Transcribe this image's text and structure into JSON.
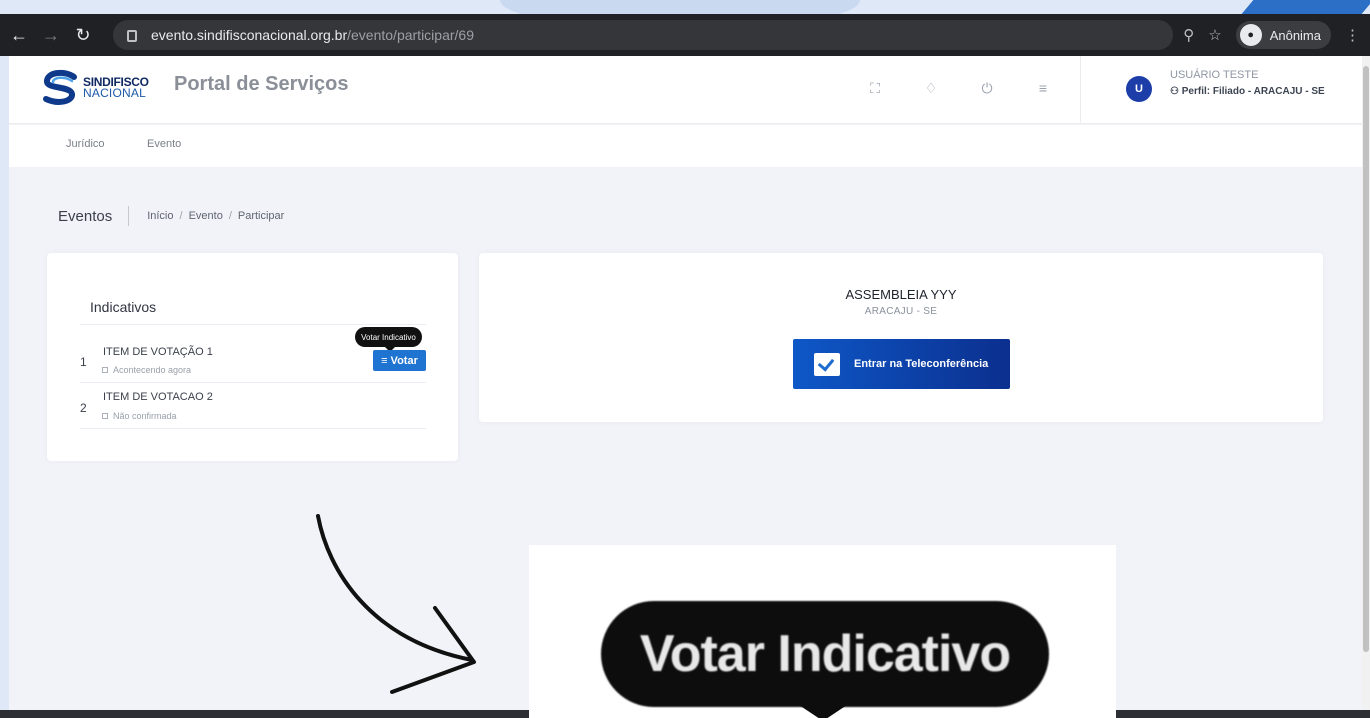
{
  "browser": {
    "url_host": "evento.sindifisconacional.org.br",
    "url_path": "/evento/participar/69",
    "incognito_label": "Anônima"
  },
  "header": {
    "logo_line1": "SINDIFISCO",
    "logo_line2": "NACIONAL",
    "portal_title": "Portal de Serviços",
    "user_initial": "U",
    "user_name": "USUÁRIO TESTE",
    "user_profile": "Perfil: Filiado - ARACAJU - SE"
  },
  "menu": {
    "items": [
      "Jurídico",
      "Evento"
    ]
  },
  "page": {
    "title": "Eventos",
    "breadcrumb": [
      "Início",
      "Evento",
      "Participar"
    ]
  },
  "indicativos": {
    "title": "Indicativos",
    "items": [
      {
        "number": "1",
        "title": "ITEM DE VOTAÇÃO 1",
        "status": "Acontecendo agora"
      },
      {
        "number": "2",
        "title": "ITEM DE VOTACAO 2",
        "status": "Não confirmada"
      }
    ],
    "tooltip": "Votar Indicativo",
    "vote_button": "Votar"
  },
  "event": {
    "name": "ASSEMBLEIA YYY",
    "location": "ARACAJU - SE",
    "join_button": "Entrar na Teleconferência"
  },
  "zoom_callout": {
    "text": "Votar Indicativo"
  },
  "colors": {
    "primary": "#1f73d1",
    "navy": "#0b2f8e",
    "tooltip_bg": "#111111"
  }
}
